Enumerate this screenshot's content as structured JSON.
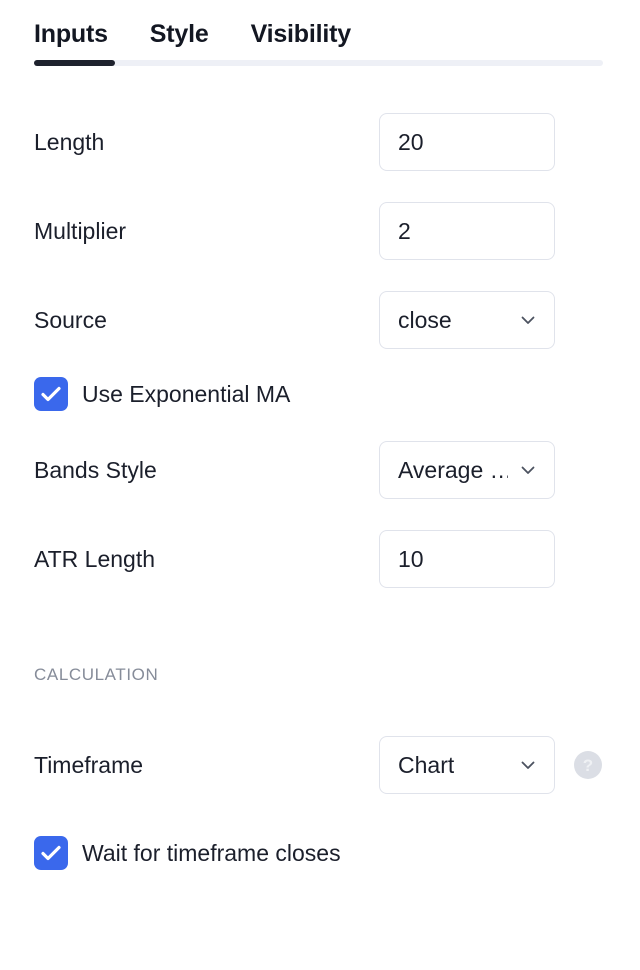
{
  "tabs": {
    "items": [
      {
        "label": "Inputs",
        "active": true
      },
      {
        "label": "Style",
        "active": false
      },
      {
        "label": "Visibility",
        "active": false
      }
    ]
  },
  "inputs": {
    "length": {
      "label": "Length",
      "value": "20",
      "type": "number-input"
    },
    "multiplier": {
      "label": "Multiplier",
      "value": "2",
      "type": "number-input"
    },
    "source": {
      "label": "Source",
      "value": "close",
      "type": "select",
      "icon": "chevron-down-icon"
    },
    "use_exponential_ma": {
      "label": "Use Exponential MA",
      "checked": true,
      "icon": "check-icon"
    },
    "bands_style": {
      "label": "Bands Style",
      "value": "Average …",
      "type": "select",
      "icon": "chevron-down-icon"
    },
    "atr_length": {
      "label": "ATR Length",
      "value": "10",
      "type": "number-input"
    }
  },
  "calculation": {
    "header": "CALCULATION",
    "timeframe": {
      "label": "Timeframe",
      "value": "Chart",
      "type": "select",
      "icon": "chevron-down-icon"
    },
    "help": {
      "icon": "help-icon",
      "glyph": "?"
    },
    "wait_for_close": {
      "label": "Wait for timeframe closes",
      "checked": true,
      "icon": "check-icon"
    }
  },
  "colors": {
    "accent_checkbox": "#3a68ec",
    "tab_active_indicator": "#1e222d",
    "tab_track": "#eef0f6",
    "field_border": "#e0e3eb",
    "text_primary": "#1b1f2b",
    "text_muted": "#868c99",
    "help_bg": "#dbdee5",
    "background": "#ffffff"
  }
}
